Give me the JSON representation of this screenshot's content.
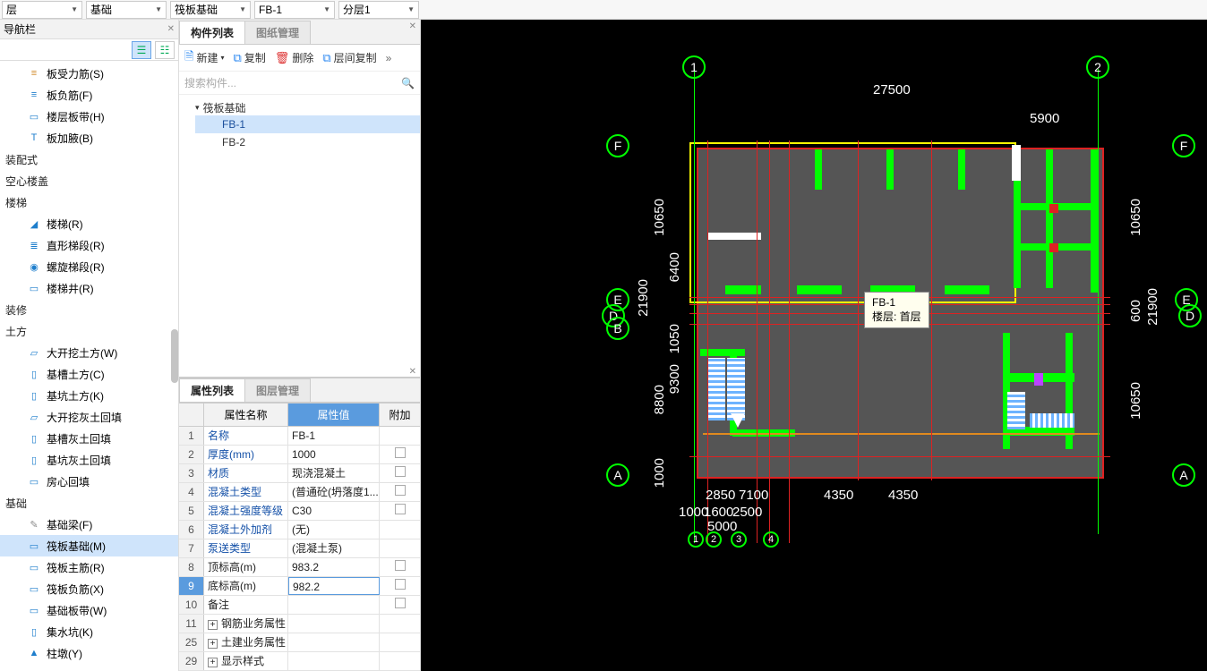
{
  "topbar": {
    "floor": "层",
    "type": "基础",
    "sub": "筏板基础",
    "item": "FB-1",
    "layer": "分层1"
  },
  "nav": {
    "title": "导航栏",
    "items": [
      {
        "label": "板受力筋(S)",
        "icon": "≡",
        "color": "#d18b2d"
      },
      {
        "label": "板负筋(F)",
        "icon": "≡",
        "color": "#1e7ecc"
      },
      {
        "label": "楼层板带(H)",
        "icon": "▭",
        "color": "#1e7ecc"
      },
      {
        "label": "板加腋(B)",
        "icon": "T",
        "color": "#1e7ecc"
      }
    ],
    "groups": [
      {
        "label": "装配式"
      },
      {
        "label": "空心楼盖"
      },
      {
        "label": "楼梯",
        "children": [
          {
            "label": "楼梯(R)",
            "icon": "◢",
            "color": "#1e7ecc"
          },
          {
            "label": "直形梯段(R)",
            "icon": "≣",
            "color": "#1e7ecc"
          },
          {
            "label": "螺旋梯段(R)",
            "icon": "◉",
            "color": "#1e7ecc"
          },
          {
            "label": "楼梯井(R)",
            "icon": "▭",
            "color": "#1e7ecc"
          }
        ]
      },
      {
        "label": "装修"
      },
      {
        "label": "土方",
        "children": [
          {
            "label": "大开挖土方(W)",
            "icon": "▱",
            "color": "#1e7ecc"
          },
          {
            "label": "基槽土方(C)",
            "icon": "▯",
            "color": "#1e7ecc"
          },
          {
            "label": "基坑土方(K)",
            "icon": "▯",
            "color": "#1e7ecc"
          },
          {
            "label": "大开挖灰土回填",
            "icon": "▱",
            "color": "#1e7ecc"
          },
          {
            "label": "基槽灰土回填",
            "icon": "▯",
            "color": "#1e7ecc"
          },
          {
            "label": "基坑灰土回填",
            "icon": "▯",
            "color": "#1e7ecc"
          },
          {
            "label": "房心回填",
            "icon": "▭",
            "color": "#1e7ecc"
          }
        ]
      },
      {
        "label": "基础",
        "children": [
          {
            "label": "基础梁(F)",
            "icon": "✎",
            "color": "#8a8a8a"
          },
          {
            "label": "筏板基础(M)",
            "icon": "▭",
            "color": "#1e7ecc",
            "selected": true
          },
          {
            "label": "筏板主筋(R)",
            "icon": "▭",
            "color": "#1e7ecc"
          },
          {
            "label": "筏板负筋(X)",
            "icon": "▭",
            "color": "#1e7ecc"
          },
          {
            "label": "基础板带(W)",
            "icon": "▭",
            "color": "#1e7ecc"
          },
          {
            "label": "集水坑(K)",
            "icon": "▯",
            "color": "#1e7ecc"
          },
          {
            "label": "柱墩(Y)",
            "icon": "▲",
            "color": "#1e7ecc"
          }
        ]
      }
    ]
  },
  "component_panel": {
    "tabs": [
      "构件列表",
      "图纸管理"
    ],
    "toolbar": {
      "new": "新建",
      "copy": "复制",
      "delete": "删除",
      "layer_copy": "层间复制"
    },
    "search_placeholder": "搜索构件...",
    "root": "筏板基础",
    "children": [
      {
        "label": "FB-1",
        "selected": true
      },
      {
        "label": "FB-2"
      }
    ]
  },
  "property_panel": {
    "tabs": [
      "属性列表",
      "图层管理"
    ],
    "headers": {
      "name": "属性名称",
      "value": "属性值",
      "extra": "附加"
    },
    "rows": [
      {
        "n": "1",
        "name": "名称",
        "value": "FB-1",
        "link": true,
        "chk": false
      },
      {
        "n": "2",
        "name": "厚度(mm)",
        "value": "1000",
        "link": true,
        "chk": true
      },
      {
        "n": "3",
        "name": "材质",
        "value": "现浇混凝土",
        "link": true,
        "chk": true
      },
      {
        "n": "4",
        "name": "混凝土类型",
        "value": "(普通砼(坍落度1...",
        "link": true,
        "chk": true
      },
      {
        "n": "5",
        "name": "混凝土强度等级",
        "value": "C30",
        "link": true,
        "chk": true
      },
      {
        "n": "6",
        "name": "混凝土外加剂",
        "value": "(无)",
        "link": true,
        "chk": false
      },
      {
        "n": "7",
        "name": "泵送类型",
        "value": "(混凝土泵)",
        "link": true,
        "chk": false
      },
      {
        "n": "8",
        "name": "顶标高(m)",
        "value": "983.2",
        "link": false,
        "chk": true
      },
      {
        "n": "9",
        "name": "底标高(m)",
        "value": "982.2",
        "link": false,
        "chk": true,
        "selected": true
      },
      {
        "n": "10",
        "name": "备注",
        "value": "",
        "link": false,
        "chk": true
      },
      {
        "n": "11",
        "name": "钢筋业务属性",
        "value": "",
        "exp": true
      },
      {
        "n": "25",
        "name": "土建业务属性",
        "value": "",
        "exp": true
      },
      {
        "n": "29",
        "name": "显示样式",
        "value": "",
        "exp": true
      }
    ]
  },
  "canvas": {
    "top_axes": [
      "1",
      "2"
    ],
    "side_axes": [
      "F",
      "E",
      "D",
      "B",
      "A"
    ],
    "bottom_axes": [
      "1",
      "2",
      "3",
      "4"
    ],
    "dims_h": {
      "total": "27500",
      "seg": "5900",
      "b1": "2850",
      "b2": "7100",
      "b3": "4350",
      "b4": "4350",
      "b5": "1000",
      "b6": "1600",
      "b7": "2500",
      "b8": "5000"
    },
    "dims_v": {
      "total": "21900",
      "t1": "10650",
      "t2": "600",
      "t3": "10650",
      "l1": "10650",
      "l2": "6400",
      "l3": "1050",
      "l4": "9300",
      "l5": "8800",
      "l6": "1000"
    },
    "tooltip": {
      "l1": "FB-1",
      "l2": "楼层: 首层"
    }
  }
}
